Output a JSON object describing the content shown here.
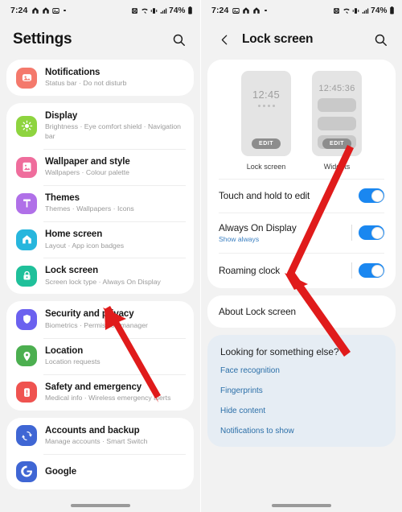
{
  "status_bar": {
    "time": "7:24",
    "battery": "74%",
    "left_icons": [
      "home-icon",
      "home-icon",
      "gallery-icon",
      "dot-icon"
    ],
    "right_icons": [
      "alarm-icon",
      "wifi-calling-icon",
      "vibrate-icon",
      "signal-icon",
      "battery-icon"
    ]
  },
  "left_panel": {
    "title": "Settings",
    "search_icon": "search-icon",
    "groups": [
      {
        "items": [
          {
            "icon": "notifications-icon",
            "color": "#f4796c",
            "title": "Notifications",
            "subtitle": "Status bar  ·  Do not disturb"
          }
        ]
      },
      {
        "items": [
          {
            "icon": "display-icon",
            "color": "#8ed43f",
            "title": "Display",
            "subtitle": "Brightness  ·  Eye comfort shield  ·  Navigation bar"
          },
          {
            "icon": "wallpaper-icon",
            "color": "#ef6d9c",
            "title": "Wallpaper and style",
            "subtitle": "Wallpapers  ·  Colour palette"
          },
          {
            "icon": "themes-icon",
            "color": "#b070e8",
            "title": "Themes",
            "subtitle": "Themes  ·  Wallpapers  ·  Icons"
          },
          {
            "icon": "home-screen-icon",
            "color": "#27b6dd",
            "title": "Home screen",
            "subtitle": "Layout  ·  App icon badges"
          },
          {
            "icon": "lock-screen-icon",
            "color": "#1fc09a",
            "title": "Lock screen",
            "subtitle": "Screen lock type  ·  Always On Display"
          }
        ]
      },
      {
        "items": [
          {
            "icon": "security-icon",
            "color": "#6b61ef",
            "title": "Security and privacy",
            "subtitle": "Biometrics  ·  Permission manager"
          },
          {
            "icon": "location-icon",
            "color": "#4caf50",
            "title": "Location",
            "subtitle": "Location requests"
          },
          {
            "icon": "safety-icon",
            "color": "#ef5350",
            "title": "Safety and emergency",
            "subtitle": "Medical info  ·  Wireless emergency alerts"
          }
        ]
      },
      {
        "items": [
          {
            "icon": "accounts-backup-icon",
            "color": "#3f66d4",
            "title": "Accounts and backup",
            "subtitle": "Manage accounts  ·  Smart Switch"
          },
          {
            "icon": "google-icon",
            "color": "#3f66d4",
            "title": "Google",
            "subtitle": ""
          }
        ]
      }
    ]
  },
  "right_panel": {
    "back_icon": "back-chevron-icon",
    "title": "Lock screen",
    "search_icon": "search-icon",
    "previews": [
      {
        "label": "Lock screen",
        "clock": "12:45",
        "edit": "EDIT",
        "kind": "lockscreen"
      },
      {
        "label": "Widgets",
        "clock": "12:45:36",
        "edit": "EDIT",
        "kind": "widgets"
      }
    ],
    "toggles": [
      {
        "title": "Touch and hold to edit",
        "subtitle": "",
        "on": true
      },
      {
        "title": "Always On Display",
        "subtitle": "Show always",
        "on": true
      },
      {
        "title": "Roaming clock",
        "subtitle": "",
        "on": true
      }
    ],
    "about_row": "About Lock screen",
    "suggestions": {
      "heading": "Looking for something else?",
      "links": [
        "Face recognition",
        "Fingerprints",
        "Hide content",
        "Notifications to show"
      ]
    }
  },
  "annotations": {
    "arrow_color": "#e01b1b",
    "left_arrow_target": "Lock screen row",
    "right_arrow_target": "Always On Display row"
  }
}
